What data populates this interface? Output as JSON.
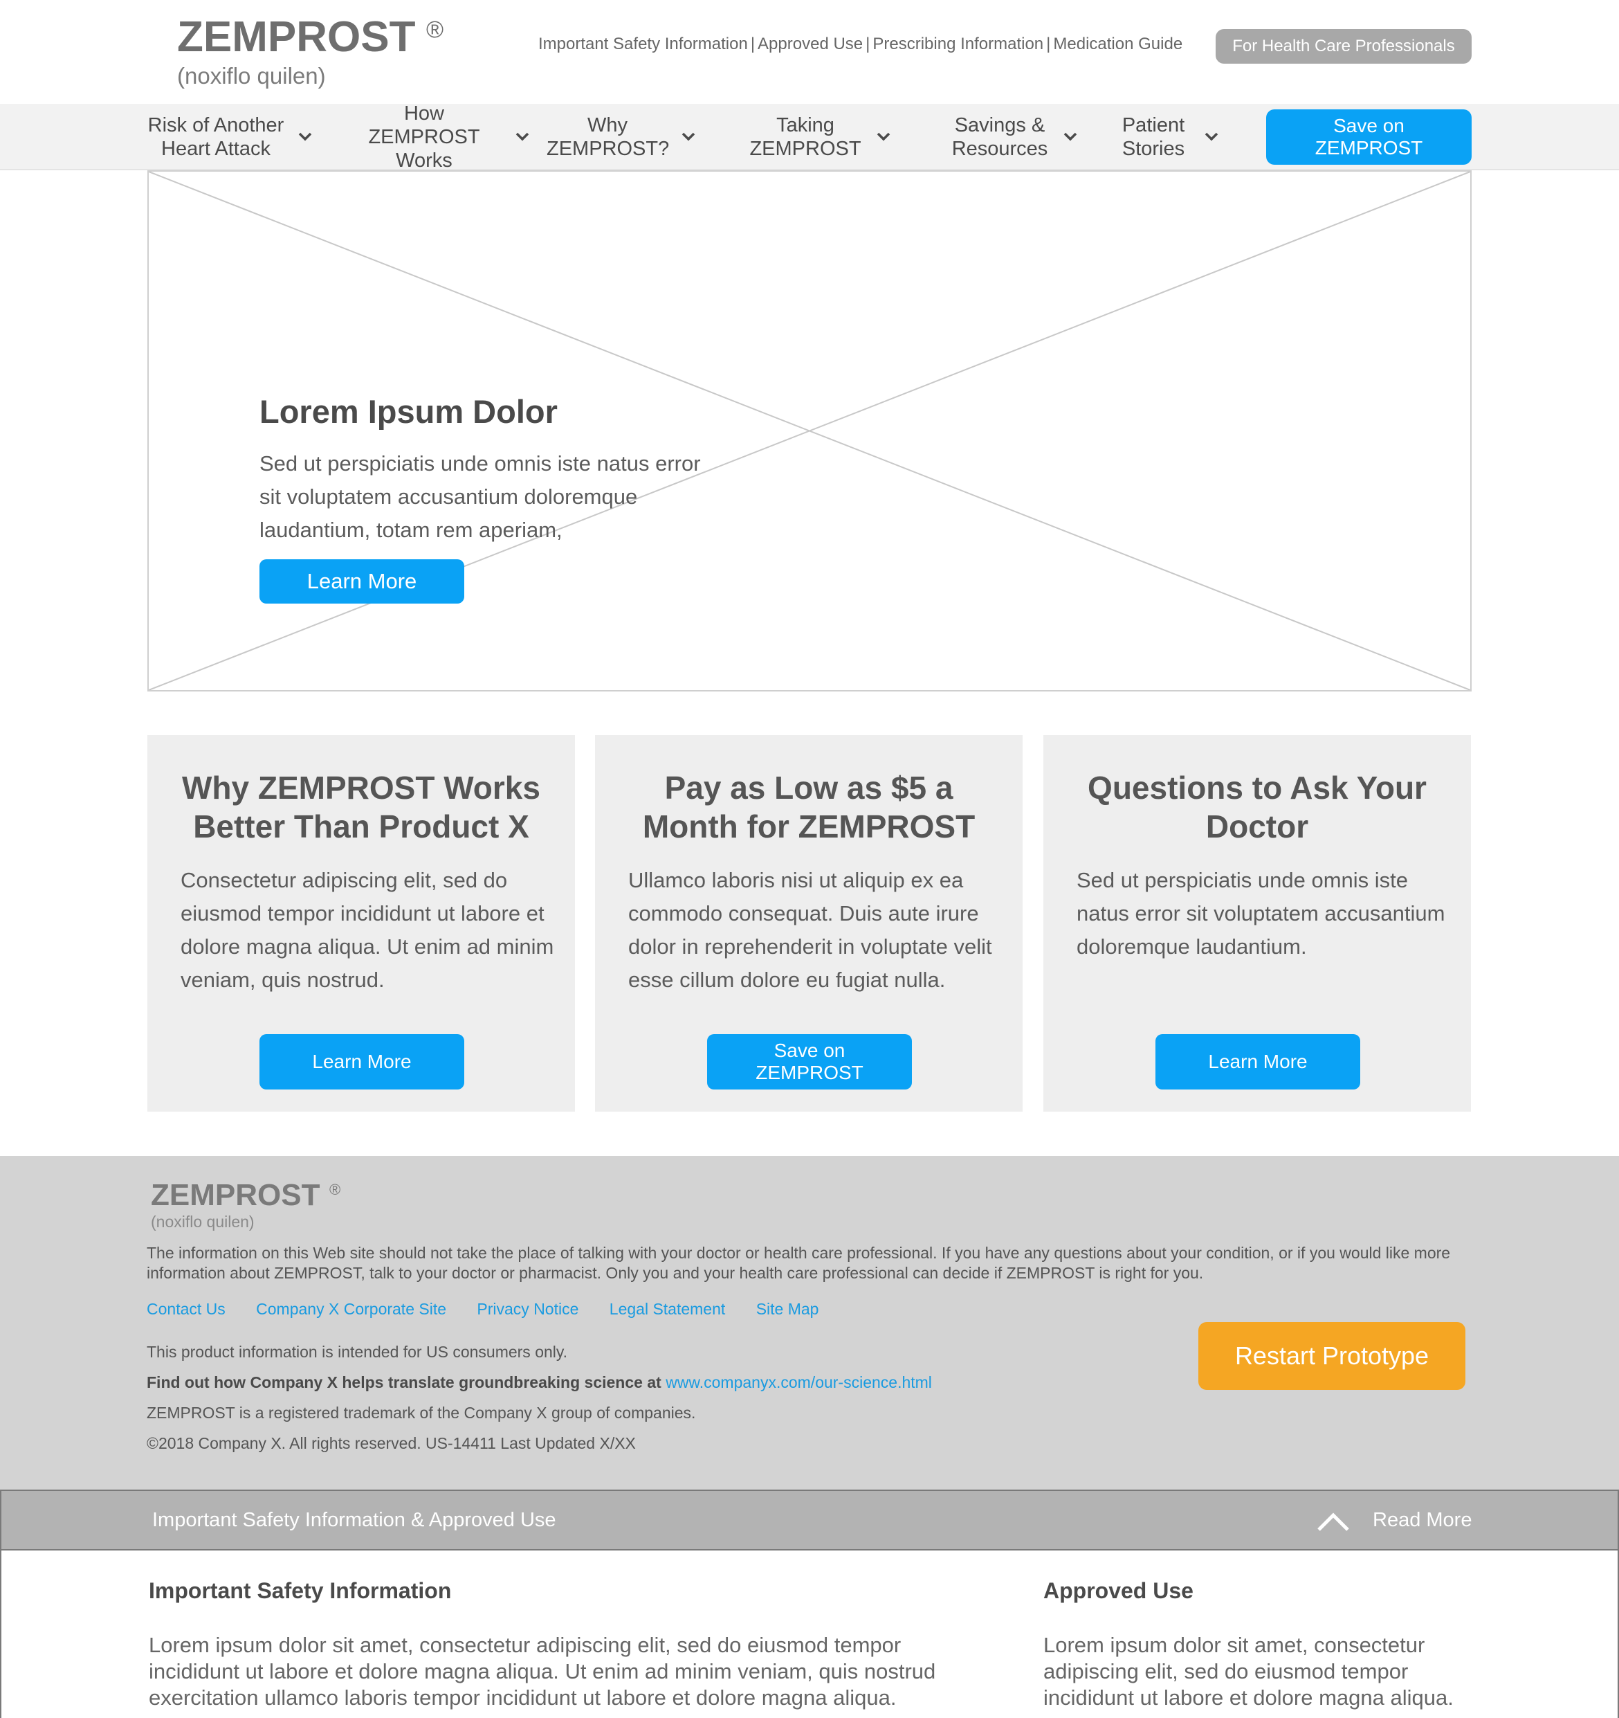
{
  "header": {
    "brand": "ZEMPROST",
    "reg_mark": "®",
    "generic": "(noxiflo quilen)",
    "util_links": [
      "Important Safety Information",
      "Approved Use",
      "Prescribing Information",
      "Medication Guide"
    ],
    "hcp_button": "For Health Care Professionals"
  },
  "nav": {
    "items": [
      {
        "label": "Risk of Another Heart Attack"
      },
      {
        "label": "How ZEMPROST Works"
      },
      {
        "label": "Why ZEMPROST?"
      },
      {
        "label": "Taking ZEMPROST"
      },
      {
        "label": "Savings & Resources"
      },
      {
        "label": "Patient Stories"
      }
    ],
    "cta": "Save on ZEMPROST"
  },
  "hero": {
    "title": "Lorem Ipsum Dolor",
    "text": "Sed ut perspiciatis unde omnis iste natus error sit voluptatem accusantium doloremque laudantium, totam rem aperiam,",
    "button": "Learn More"
  },
  "cards": [
    {
      "title": "Why ZEMPROST Works Better Than Product X",
      "text": "Consectetur adipiscing elit, sed do eiusmod tempor incididunt ut labore et dolore magna aliqua. Ut enim ad minim veniam, quis nostrud.",
      "button": "Learn More"
    },
    {
      "title": "Pay as Low as $5 a Month for ZEMPROST",
      "text": "Ullamco laboris nisi ut aliquip ex ea commodo consequat. Duis aute irure dolor in reprehenderit in voluptate velit esse cillum dolore eu fugiat nulla.",
      "button": "Save on ZEMPROST"
    },
    {
      "title": "Questions to Ask Your Doctor",
      "text": "Sed ut perspiciatis unde omnis iste natus error sit voluptatem accusantium doloremque laudantium.",
      "button": "Learn More"
    }
  ],
  "footer": {
    "brand": "ZEMPROST",
    "reg_mark": "®",
    "generic": "(noxiflo quilen)",
    "disclaimer": "The information on this Web site should not take the place of talking with your doctor or health care professional. If you have any questions about your condition, or if you would like more information about ZEMPROST, talk to your doctor or pharmacist. Only you and your health care professional can decide if ZEMPROST is right for you.",
    "links": [
      "Contact Us",
      "Company X Corporate Site",
      "Privacy Notice",
      "Legal Statement",
      "Site Map"
    ],
    "us_only": "This product information is intended for US consumers only.",
    "science_text": "Find out how Company X helps translate groundbreaking science at",
    "science_link": "www.companyx.com/our-science.html",
    "trademark": "ZEMPROST is a registered trademark of the Company X group of companies.",
    "copyright": "©2018 Company X. All rights reserved. US-14411 Last Updated X/XX",
    "restart_button": "Restart Prototype"
  },
  "isi": {
    "bar_title": "Important Safety Information & Approved Use",
    "read_more": "Read More",
    "safety_heading": "Important Safety Information",
    "safety_text": "Lorem ipsum dolor sit amet, consectetur adipiscing elit, sed do eiusmod tempor incididunt ut labore et dolore magna aliqua. Ut enim ad minim veniam, quis nostrud exercitation ullamco laboris tempor incididunt ut labore et dolore magna aliqua.",
    "approved_heading": "Approved Use",
    "approved_text": "Lorem ipsum dolor sit amet, consectetur adipiscing elit, sed do eiusmod tempor incididunt ut labore et dolore magna aliqua."
  },
  "colors": {
    "accent": "#0aa2f5",
    "restart": "#f5a623",
    "nav_bg": "#f2f2f2",
    "footer_bg": "#d3d3d3",
    "isi_bar": "#b3b3b3"
  },
  "icons": {
    "nav_chevron": "chevron-down-icon",
    "isi_toggle": "chevron-up-icon",
    "hero_placeholder": "image-placeholder-icon"
  }
}
